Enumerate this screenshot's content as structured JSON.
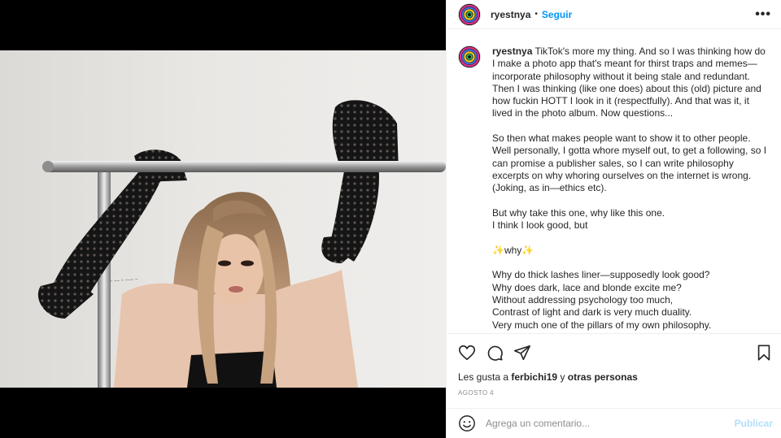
{
  "post": {
    "username": "ryestnya",
    "separator": "•",
    "follow_label": "Seguir",
    "more_label": "•••"
  },
  "caption": {
    "username": "ryestnya",
    "paragraphs": [
      "TikTok's more my thing. And so I was thinking how do I make a photo app that's meant for thirst traps and memes—incorporate philosophy without it being stale and redundant. Then I was thinking (like one does) about this (old) picture and how fuckin HOTT I look in it (respectfully). And that was it, it lived in the photo album. Now questions...",
      "So then what makes people want to show it to other people. Well personally, I gotta whore myself out, to get a following, so I can promise a publisher sales, so I can write philosophy excerpts on why whoring ourselves on the internet is wrong. (Joking, as in—ethics etc).",
      "But why take this one, why like this one.",
      "I think I look good, but",
      "✨why✨",
      "Why do thick lashes liner—supposedly look good?",
      "Why does dark, lace and blonde excite me?",
      "Without addressing psychology too much,",
      "Contrast of light and dark is very much duality.",
      "Very much one of the pillars of my own philosophy."
    ]
  },
  "likes": {
    "prefix": "Les gusta a",
    "user": "ferbichi19",
    "joiner": "y",
    "others": "otras personas"
  },
  "date": "AGOSTO 4",
  "comment": {
    "placeholder": "Agrega un comentario...",
    "post_label": "Publicar"
  },
  "icons": {
    "like": "heart-icon",
    "comment": "comment-icon",
    "share": "share-icon",
    "save": "bookmark-icon",
    "emoji": "emoji-icon"
  },
  "colors": {
    "accent": "#0095f6",
    "post_disabled": "#b2dffc",
    "muted": "#8e8e8e"
  }
}
